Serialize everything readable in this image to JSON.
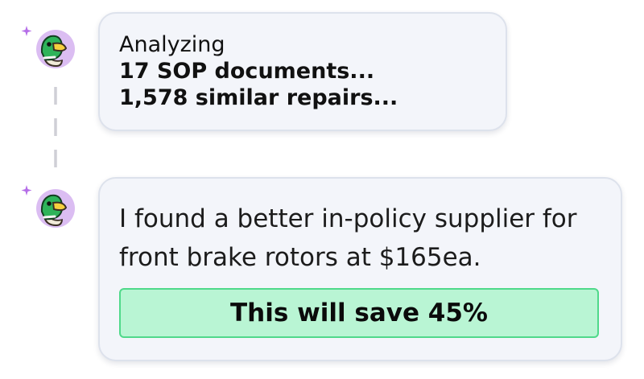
{
  "colors": {
    "bubble_background": "#f3f5fa",
    "bubble_border": "#dde2ec",
    "avatar_background": "#dbbdf2",
    "sparkle": "#b56ee8",
    "savings_background": "#b9f5d4",
    "savings_border": "#4fd98a",
    "duck_head": "#2eb35a"
  },
  "icons": {
    "avatar": "duck-icon",
    "sparkle": "sparkle-icon",
    "connector": "dashed-line"
  },
  "analysis_message": {
    "status": "Analyzing",
    "documents": "17 SOP documents...",
    "repairs": "1,578 similar repairs..."
  },
  "result_message": {
    "text": "I found a better in-policy supplier for front brake rotors at $165ea.",
    "savings_label": "This will save 45%"
  }
}
